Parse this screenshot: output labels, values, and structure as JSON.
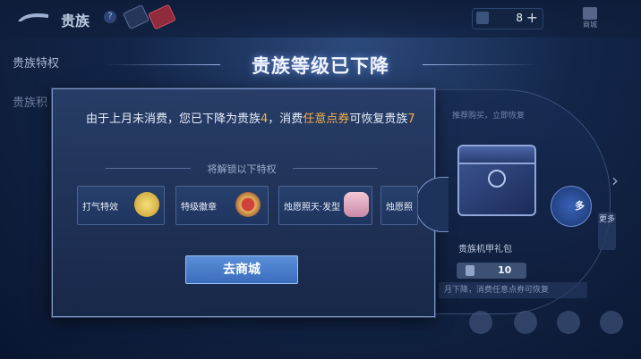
{
  "topbar": {
    "title": "贵族",
    "help": "?",
    "currency_value": "8",
    "currency_plus": "+",
    "shop_label": "商城"
  },
  "sidebar": {
    "item1": "贵族特权",
    "item2": "贵族积"
  },
  "dialog": {
    "title": "贵族等级已下降",
    "message_part1": "由于上月未消费，您已下降为贵族",
    "level_now": "4",
    "message_part2": "，消费",
    "currency_name": "任意点券",
    "message_part3": "可恢复贵族",
    "level_restore": "7",
    "unlock_heading": "将解锁以下特权",
    "perks": [
      {
        "label": "打气特效",
        "icon": "fist-emblem-icon"
      },
      {
        "label": "特级徽章",
        "icon": "badge-icon"
      },
      {
        "label": "烛愿照天·发型",
        "icon": "hairstyle-portrait-icon"
      },
      {
        "label": "烛愿照",
        "icon": "partial-portrait-icon"
      }
    ],
    "go_button": "去商城"
  },
  "right_panel": {
    "header": "推荐购买，立即恢复",
    "pack_name": "贵族机甲礼包",
    "price": "10",
    "more": "更多",
    "strip_text": "月下降，消费任意点券可恢复"
  },
  "colors": {
    "highlight": "#f3b04a",
    "button": "#4a7dcc",
    "dialog_bg": "#223a66"
  }
}
